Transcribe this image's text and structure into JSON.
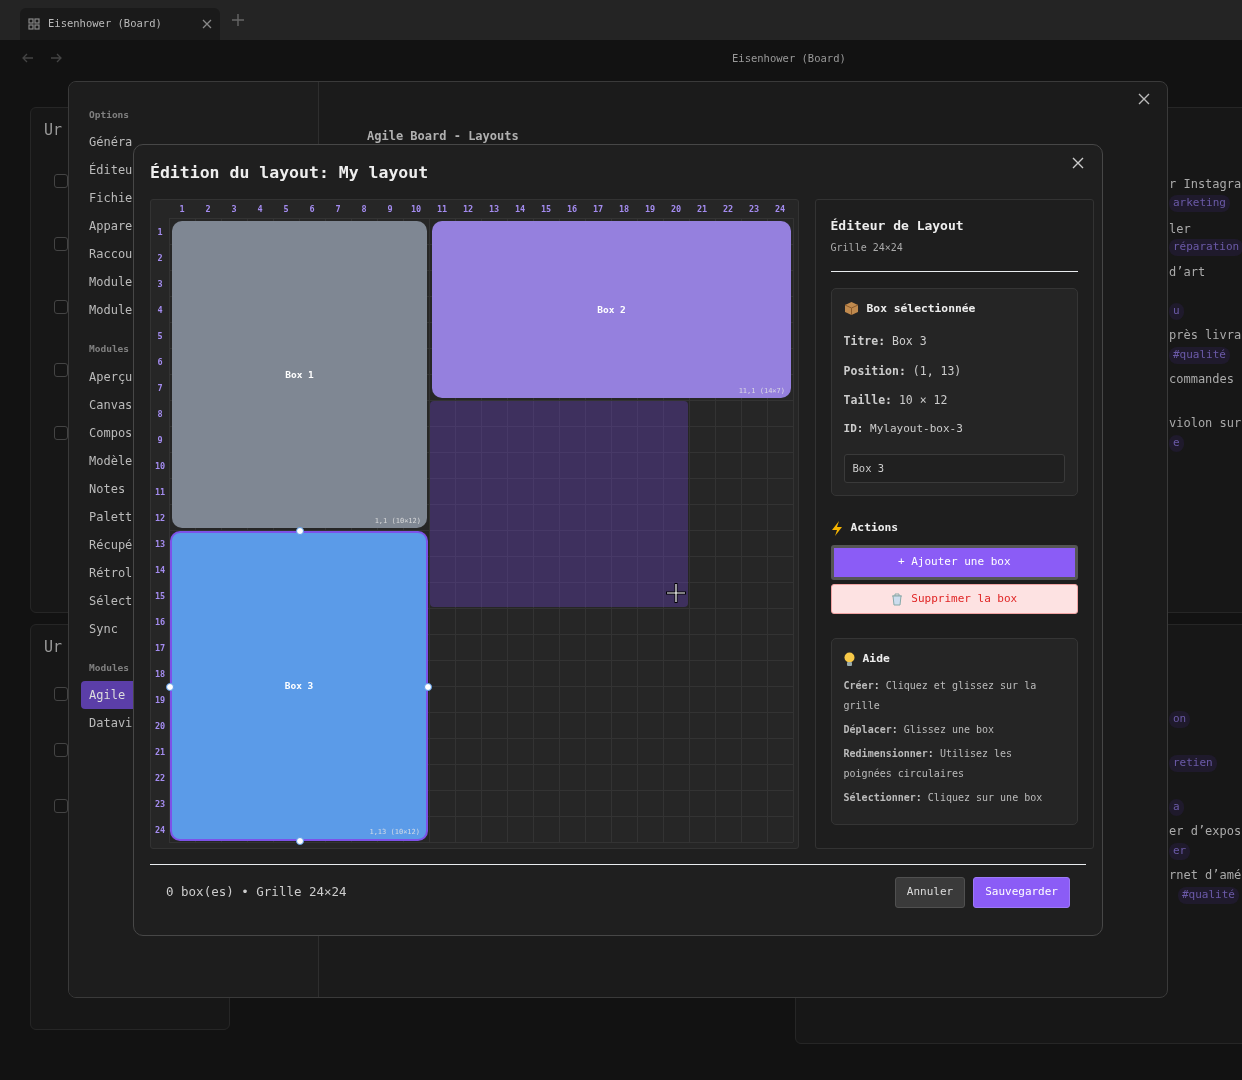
{
  "tab": {
    "title": "Eisenhower (Board)"
  },
  "page_title": "Eisenhower (Board)",
  "background": {
    "left_cards": [
      {
        "title": "Ur",
        "checkboxes": [
          {
            "checked": false
          },
          {
            "checked": false
          },
          {
            "checked": false
          },
          {
            "checked": false
          },
          {
            "checked": false
          }
        ]
      },
      {
        "title": "Ur",
        "checkboxes": [
          {
            "checked": false
          },
          {
            "checked": false
          },
          {
            "checked": false
          }
        ]
      }
    ],
    "right_items": [
      {
        "kind": "text",
        "text": "r Instagra"
      },
      {
        "kind": "tag",
        "text": "arketing"
      },
      {
        "kind": "text",
        "text": "ler"
      },
      {
        "kind": "tag",
        "text": "réparation"
      },
      {
        "kind": "text",
        "text": "d’art"
      },
      {
        "kind": "tag",
        "text": "u"
      },
      {
        "kind": "text",
        "text": "près livra"
      },
      {
        "kind": "tag",
        "text": "#qualité"
      },
      {
        "kind": "text",
        "text": "commandes"
      },
      {
        "kind": "text",
        "text": "violon sur"
      },
      {
        "kind": "tag",
        "text": "e"
      },
      {
        "kind": "tag",
        "text": "on"
      },
      {
        "kind": "tag",
        "text": "retien"
      },
      {
        "kind": "tag",
        "text": "a"
      },
      {
        "kind": "text",
        "text": "er d’expos"
      },
      {
        "kind": "tag",
        "text": "er"
      },
      {
        "kind": "text",
        "text": "rnet d’amé"
      },
      {
        "kind": "tag",
        "text": "#qualité"
      }
    ]
  },
  "settings": {
    "sidebar": [
      {
        "kind": "section",
        "label": "Options"
      },
      {
        "kind": "item",
        "label": "Généra",
        "selected": false
      },
      {
        "kind": "item",
        "label": "Éditeu",
        "selected": false
      },
      {
        "kind": "item",
        "label": "Fichie",
        "selected": false
      },
      {
        "kind": "item",
        "label": "Appare",
        "selected": false
      },
      {
        "kind": "item",
        "label": "Raccou",
        "selected": false
      },
      {
        "kind": "item",
        "label": "Module",
        "selected": false
      },
      {
        "kind": "item",
        "label": "Module",
        "selected": false
      },
      {
        "kind": "section",
        "label": "Modules"
      },
      {
        "kind": "item",
        "label": "Aperçu",
        "selected": false
      },
      {
        "kind": "item",
        "label": "Canvas",
        "selected": false
      },
      {
        "kind": "item",
        "label": "Compos",
        "selected": false
      },
      {
        "kind": "item",
        "label": "Modèle",
        "selected": false
      },
      {
        "kind": "item",
        "label": "Notes",
        "selected": false
      },
      {
        "kind": "item",
        "label": "Palett",
        "selected": false
      },
      {
        "kind": "item",
        "label": "Récupé",
        "selected": false
      },
      {
        "kind": "item",
        "label": "Rétrol",
        "selected": false
      },
      {
        "kind": "item",
        "label": "Sélect",
        "selected": false
      },
      {
        "kind": "item",
        "label": "Sync",
        "selected": false
      },
      {
        "kind": "section",
        "label": "Modules"
      },
      {
        "kind": "item",
        "label": "Agile",
        "selected": true
      },
      {
        "kind": "item",
        "label": "Datavi",
        "selected": false
      }
    ],
    "content_title": "Agile Board - Layouts"
  },
  "editor": {
    "title": "Édition du layout: My layout",
    "grid": {
      "column_labels": [
        "1",
        "2",
        "3",
        "4",
        "5",
        "6",
        "7",
        "8",
        "9",
        "10",
        "11",
        "12",
        "13",
        "14",
        "15",
        "16",
        "17",
        "18",
        "19",
        "20",
        "21",
        "22",
        "23",
        "24"
      ],
      "row_labels": [
        "1",
        "2",
        "3",
        "4",
        "5",
        "6",
        "7",
        "8",
        "9",
        "10",
        "11",
        "12",
        "13",
        "14",
        "15",
        "16",
        "17",
        "18",
        "19",
        "20",
        "21",
        "22",
        "23",
        "24"
      ],
      "boxes": [
        {
          "title": "Box 1",
          "coords": "1,1 (10×12)",
          "color": "#7f8793",
          "selected": false
        },
        {
          "title": "Box 2",
          "coords": "11,1 (14×7)",
          "color": "#9580de",
          "selected": false
        },
        {
          "title": "Box 3",
          "coords": "1,13 (10×12)",
          "color": "#5b9be8",
          "selected": true
        }
      ]
    },
    "panel": {
      "title": "Éditeur de Layout",
      "subtitle": "Grille 24×24",
      "selection": {
        "heading": "Box sélectionnée",
        "fields": [
          {
            "label": "Titre:",
            "value": "Box 3"
          },
          {
            "label": "Position:",
            "value": "(1, 13)"
          },
          {
            "label": "Taille:",
            "value": "10 × 12"
          },
          {
            "label": "ID:",
            "value": "Mylayout-box-3"
          }
        ],
        "title_input": {
          "value": "Box 3"
        }
      },
      "actions": {
        "heading": "Actions",
        "buttons": [
          {
            "kind": "primary",
            "label": "+ Ajouter une box"
          },
          {
            "kind": "danger",
            "label": "Supprimer la box"
          }
        ]
      },
      "help": {
        "heading": "Aide",
        "lines": [
          {
            "label": "Créer:",
            "text": "Cliquez et glissez sur la grille"
          },
          {
            "label": "Déplacer:",
            "text": "Glissez une box"
          },
          {
            "label": "Redimensionner:",
            "text": "Utilisez les poignées circulaires"
          },
          {
            "label": "Sélectionner:",
            "text": "Cliquez sur une box"
          }
        ]
      }
    },
    "status": "0 box(es) • Grille 24×24",
    "buttons": [
      {
        "kind": "secondary",
        "label": "Annuler"
      },
      {
        "kind": "primary",
        "label": "Sauvegarder"
      }
    ]
  }
}
